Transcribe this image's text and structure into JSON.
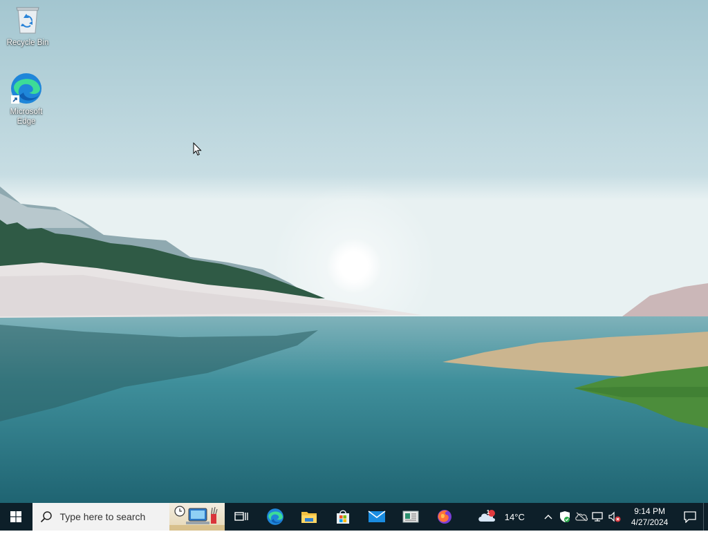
{
  "desktop": {
    "icons": [
      {
        "label": "Recycle Bin",
        "icon": "recycle-bin-icon"
      },
      {
        "label": "Microsoft Edge",
        "icon": "edge-icon"
      }
    ]
  },
  "taskbar": {
    "start_icon": "windows-logo-icon",
    "search": {
      "placeholder": "Type here to search",
      "icon": "search-icon"
    },
    "pinned": [
      {
        "name": "Task View",
        "icon": "task-view-icon"
      },
      {
        "name": "Microsoft Edge",
        "icon": "edge-icon"
      },
      {
        "name": "File Explorer",
        "icon": "folder-icon"
      },
      {
        "name": "Microsoft Store",
        "icon": "store-icon"
      },
      {
        "name": "Mail",
        "icon": "mail-icon"
      },
      {
        "name": "News",
        "icon": "news-icon"
      },
      {
        "name": "Firefox",
        "icon": "firefox-icon"
      }
    ],
    "weather": {
      "temperature": "14°C",
      "badge": "1",
      "icon": "cloud-icon"
    },
    "tray": [
      "chevron-up-icon",
      "shield-icon",
      "no-network-icon",
      "network-icon",
      "volume-muted-icon"
    ],
    "clock": {
      "time": "9:14 PM",
      "date": "4/27/2024"
    },
    "notification_icon": "notification-icon"
  },
  "colors": {
    "taskbar": "#0d1f29",
    "search_bg": "#f2f2f2",
    "accent": "#0078d4"
  }
}
